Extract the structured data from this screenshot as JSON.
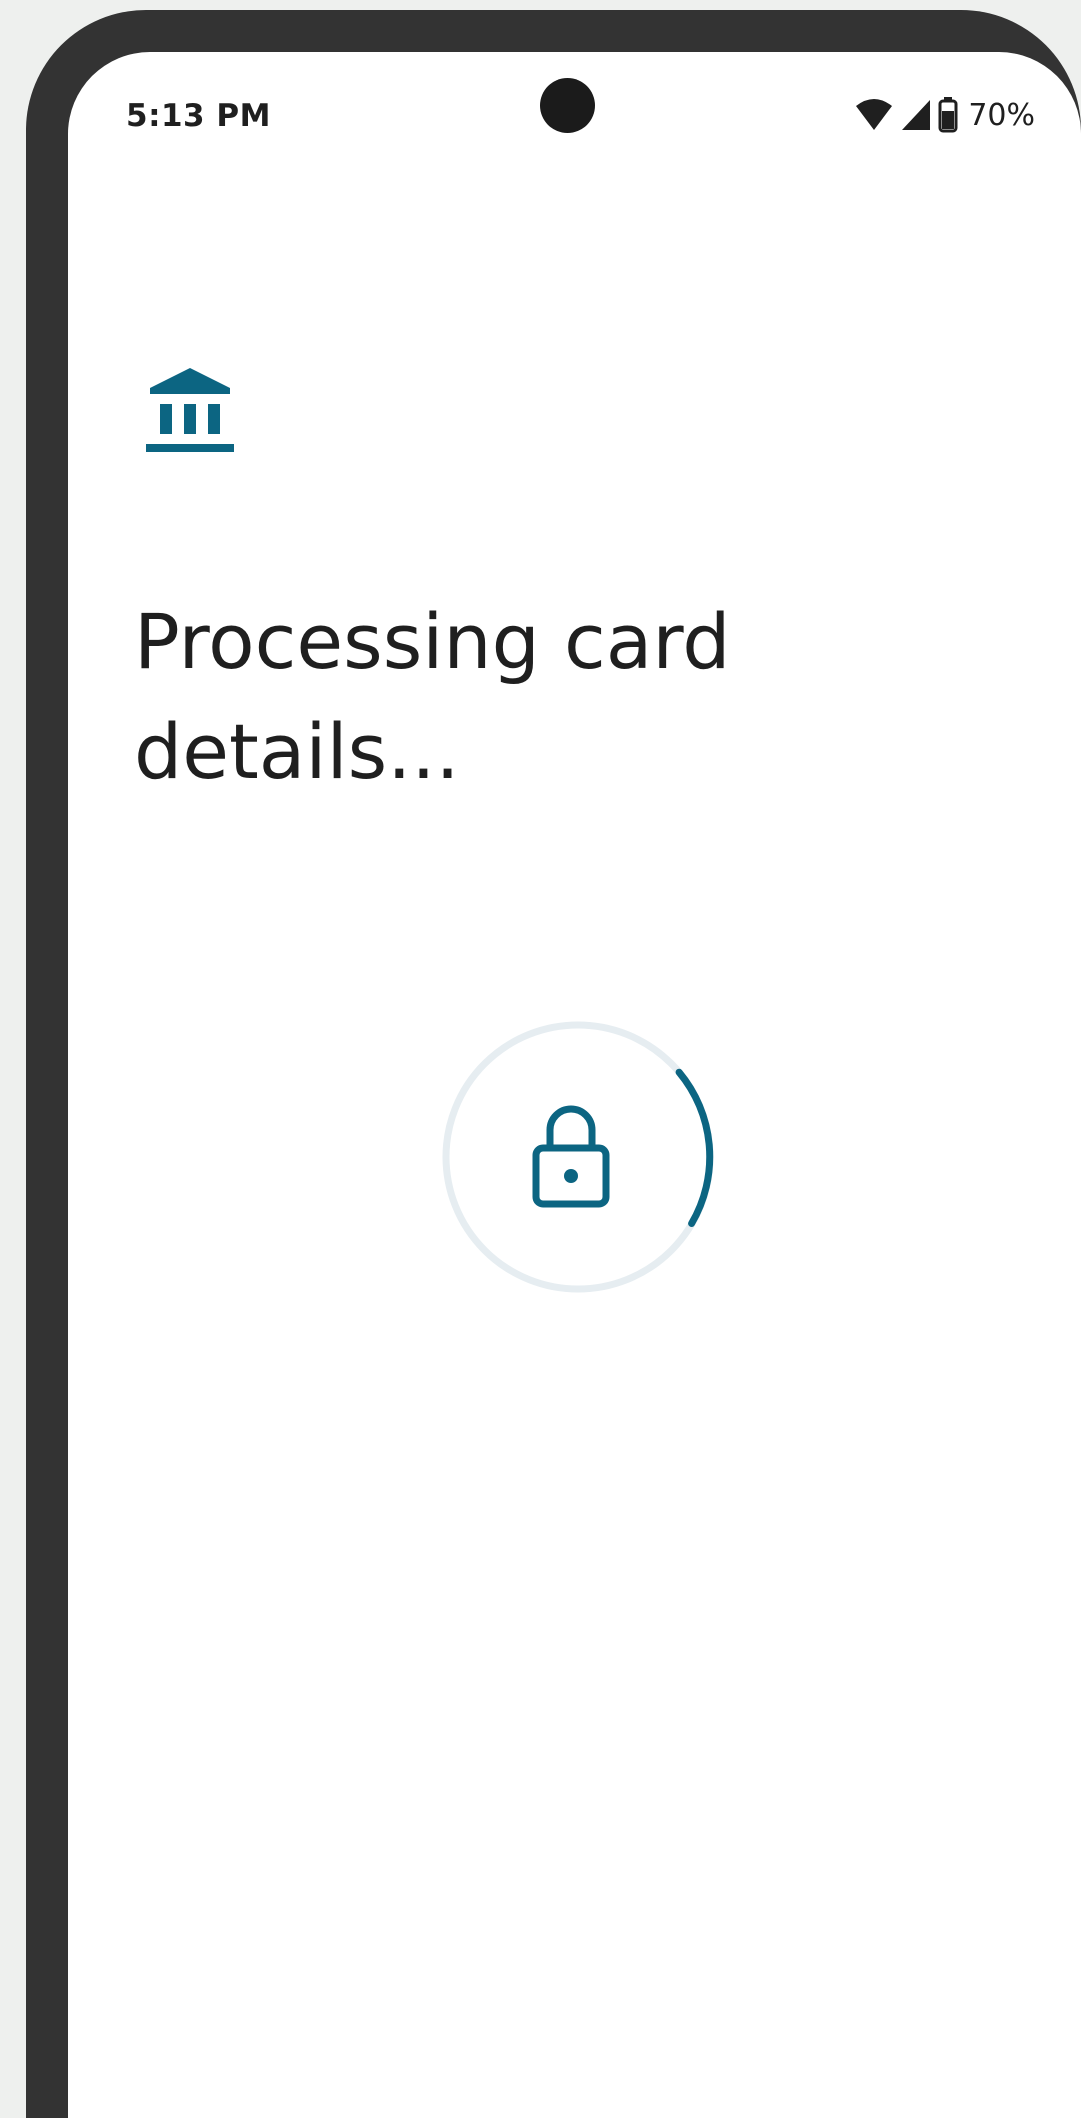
{
  "status_bar": {
    "time": "5:13 PM",
    "battery_percent": "70%",
    "icons": [
      "wifi-icon",
      "cell-signal-icon",
      "battery-icon"
    ]
  },
  "header": {
    "icon": "bank-icon"
  },
  "main": {
    "title": "Processing card details...",
    "loader_icon": "lock-icon"
  },
  "colors": {
    "accent": "#0c6582",
    "text": "#1f1f1f",
    "spinner_track": "#e6edf1",
    "frame": "#333333",
    "background": "#ffffff"
  }
}
